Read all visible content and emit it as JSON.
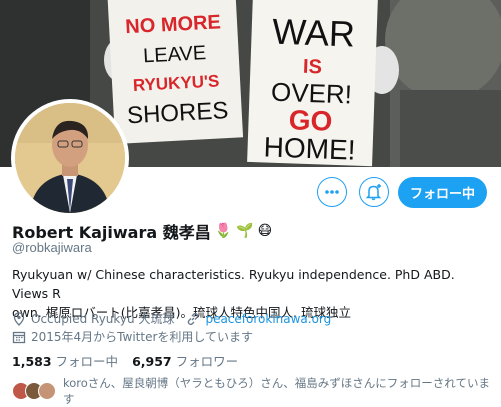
{
  "banner": {
    "sign_left": [
      "NO MORE",
      "LEAVE",
      "RYUKYU'S",
      "SHORES"
    ],
    "sign_right": [
      "WAR",
      "IS",
      "OVER!",
      "GO",
      "HOME!"
    ]
  },
  "actions": {
    "more_icon": "more-dots-icon",
    "notify_icon": "bell-plus-icon",
    "follow_label": "フォロー中"
  },
  "profile": {
    "name": "Robert Kajiwara 魏孝昌",
    "emojis": [
      "🌷",
      "🌱",
      "😷"
    ],
    "handle": "@robkajiwara",
    "bio_line1": "Ryukyuan w/ Chinese characteristics. Ryukyu independence. PhD ABD. Views R",
    "bio_line2": "own. 梶原ロバート(比嘉孝昌)。琉球人特色中国人. 琉球独立",
    "location": "Occupied Ryukyu 大琉球",
    "website": "peaceforokinawa.org",
    "joined": "2015年4月からTwitterを利用しています"
  },
  "stats": {
    "following_count": "1,583",
    "following_label": "フォロー中",
    "followers_count": "6,957",
    "followers_label": "フォロワー"
  },
  "followed_by": "koroさん、屋良朝博（ヤラともひろ）さん、福島みずほさんにフォローされています",
  "colors": {
    "accent": "#1da1f2",
    "link": "#1b95e0",
    "muted": "#657786",
    "sign_red": "#d8262a"
  }
}
